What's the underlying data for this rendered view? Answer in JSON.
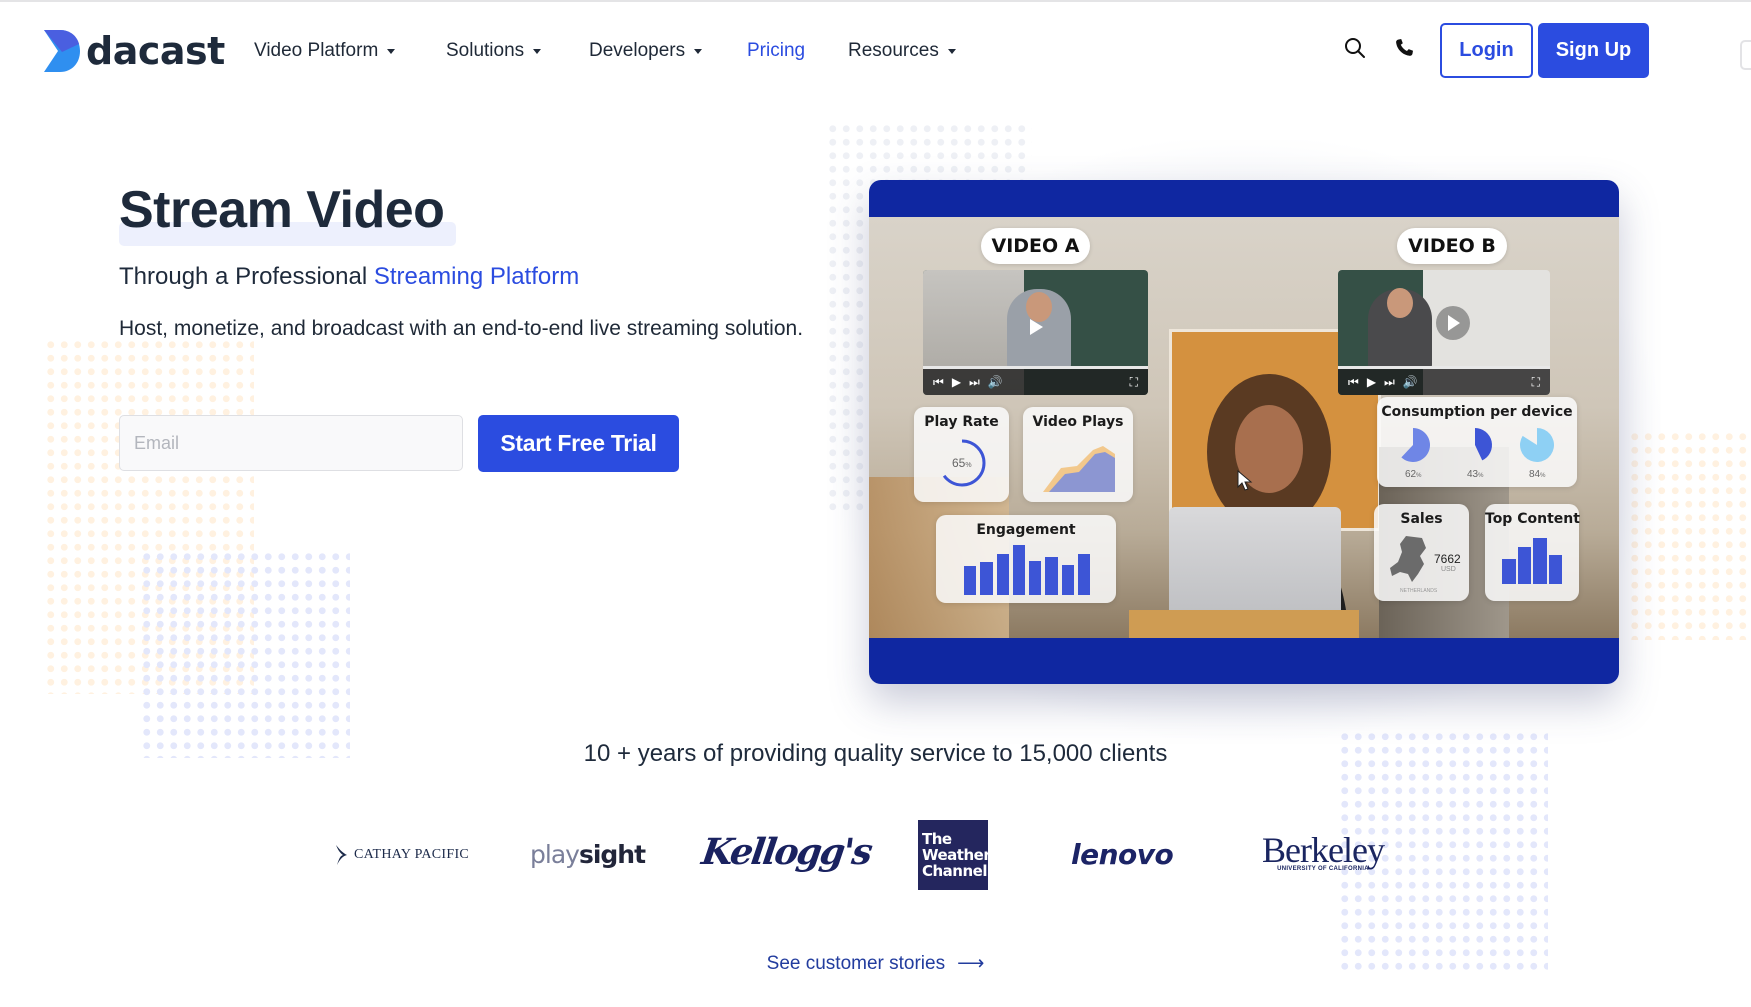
{
  "header": {
    "logo_text": "dacast",
    "nav": [
      {
        "label": "Video Platform",
        "has_dropdown": true,
        "active": false
      },
      {
        "label": "Solutions",
        "has_dropdown": true,
        "active": false
      },
      {
        "label": "Developers",
        "has_dropdown": true,
        "active": false
      },
      {
        "label": "Pricing",
        "has_dropdown": false,
        "active": true
      },
      {
        "label": "Resources",
        "has_dropdown": true,
        "active": false
      }
    ],
    "icons": [
      "search-icon",
      "phone-icon"
    ],
    "login_label": "Login",
    "signup_label": "Sign Up"
  },
  "hero": {
    "title": "Stream Video",
    "subtitle_prefix": "Through a Professional ",
    "subtitle_accent": "Streaming Platform",
    "description": "Host, monetize, and broadcast with an end-to-end live streaming solution.",
    "email_placeholder": "Email",
    "email_value": "",
    "cta_label": "Start Free Trial"
  },
  "video_card": {
    "video_a_label": "VIDEO A",
    "video_b_label": "VIDEO B",
    "widgets": {
      "play_rate": {
        "title": "Play Rate",
        "value": "65",
        "unit": "%",
        "fraction": 0.65
      },
      "video_plays": {
        "title": "Video Plays"
      },
      "engagement": {
        "title": "Engagement",
        "bars": [
          0.58,
          0.66,
          0.82,
          1.0,
          0.68,
          0.77,
          0.6,
          0.82
        ]
      },
      "consumption": {
        "title": "Consumption per device",
        "devices": [
          {
            "value": "62",
            "unit": "%",
            "fraction": 0.62,
            "color": "#6f86e6"
          },
          {
            "value": "43",
            "unit": "%",
            "fraction": 0.43,
            "color": "#3d55d6"
          },
          {
            "value": "84",
            "unit": "%",
            "fraction": 0.84,
            "color": "#8ed0f4"
          }
        ]
      },
      "sales": {
        "title": "Sales",
        "value": "7662",
        "currency": "USD",
        "region": "NETHERLANDS"
      },
      "top_content": {
        "title": "Top Content",
        "bars": [
          0.55,
          0.8,
          1.0,
          0.63
        ]
      }
    }
  },
  "clients": {
    "tagline": "10 + years of providing quality service to 15,000 clients",
    "logos": [
      {
        "name": "CATHAY PACIFIC"
      },
      {
        "name_part1": "play",
        "name_part2": "sight"
      },
      {
        "name": "Kellogg's"
      },
      {
        "lines": [
          "The",
          "Weather",
          "Channel"
        ]
      },
      {
        "name": "lenovo"
      },
      {
        "name": "Berkeley",
        "sub": "UNIVERSITY OF CALIFORNIA"
      }
    ],
    "stories_link": "See customer stories",
    "stories_arrow": "⟶"
  },
  "colors": {
    "brand_blue": "#2b4ce0",
    "card_blue": "#0f27a1",
    "heading": "#1e2a3b"
  }
}
